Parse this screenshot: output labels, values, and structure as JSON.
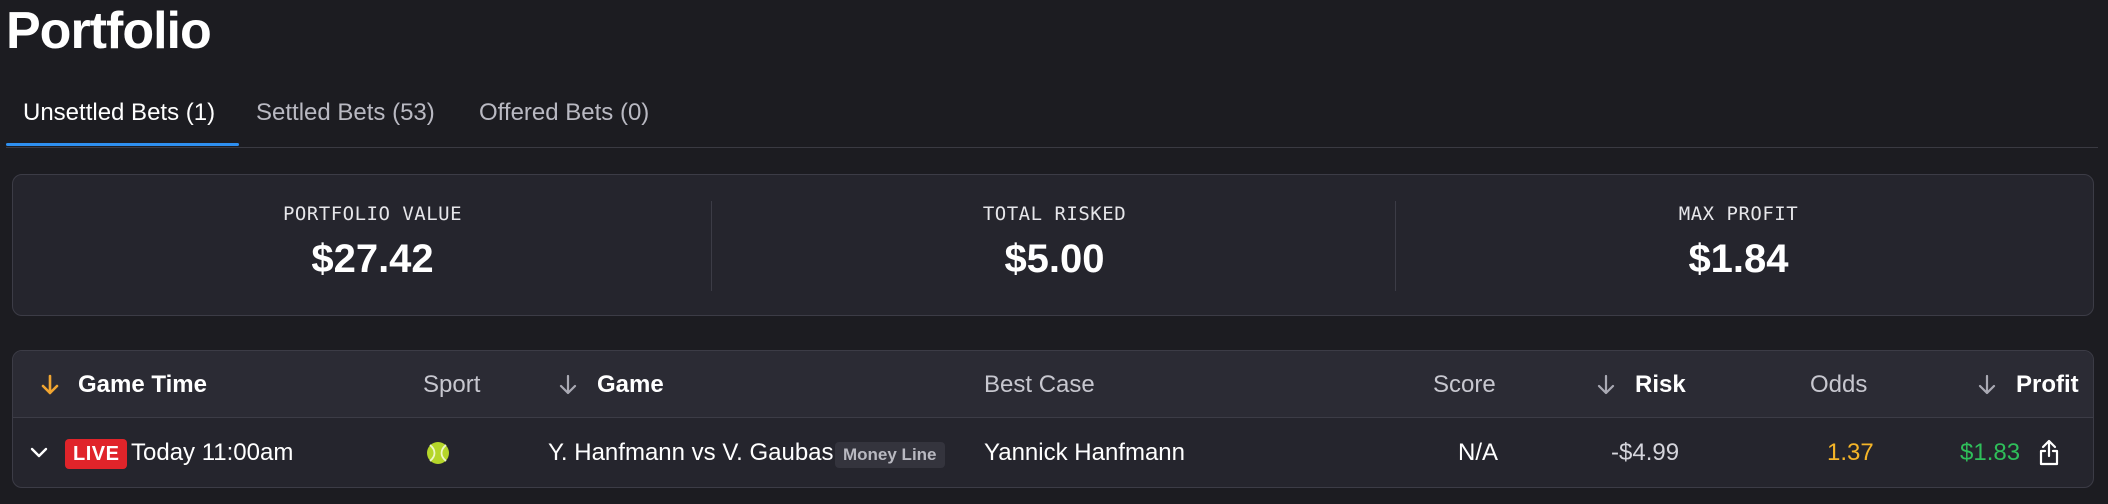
{
  "page": {
    "title": "Portfolio"
  },
  "tabs": [
    {
      "label": "Unsettled Bets (1)",
      "active": true
    },
    {
      "label": "Settled Bets (53)",
      "active": false
    },
    {
      "label": "Offered Bets (0)",
      "active": false
    }
  ],
  "summary": {
    "portfolio_value": {
      "label": "PORTFOLIO VALUE",
      "value": "$27.42"
    },
    "total_risked": {
      "label": "TOTAL RISKED",
      "value": "$5.00"
    },
    "max_profit": {
      "label": "MAX PROFIT",
      "value": "$1.84"
    }
  },
  "table": {
    "columns": {
      "game_time": "Game Time",
      "sport": "Sport",
      "game": "Game",
      "best_case": "Best Case",
      "score": "Score",
      "risk": "Risk",
      "odds": "Odds",
      "profit": "Profit"
    },
    "rows": [
      {
        "live_label": "LIVE",
        "game_time": "Today 11:00am",
        "sport_icon": "tennis-ball-icon",
        "game": "Y. Hanfmann vs V. Gaubas",
        "market": "Money Line",
        "best_case": "Yannick Hanfmann",
        "score": "N/A",
        "risk": "-$4.99",
        "odds": "1.37",
        "profit": "$1.83"
      }
    ]
  },
  "colors": {
    "background": "#1c1c21",
    "accent_tab": "#2e8ff0",
    "sort_active": "#f0a531",
    "live": "#e0242a",
    "odds": "#f5b528",
    "profit": "#2fbf5a"
  }
}
